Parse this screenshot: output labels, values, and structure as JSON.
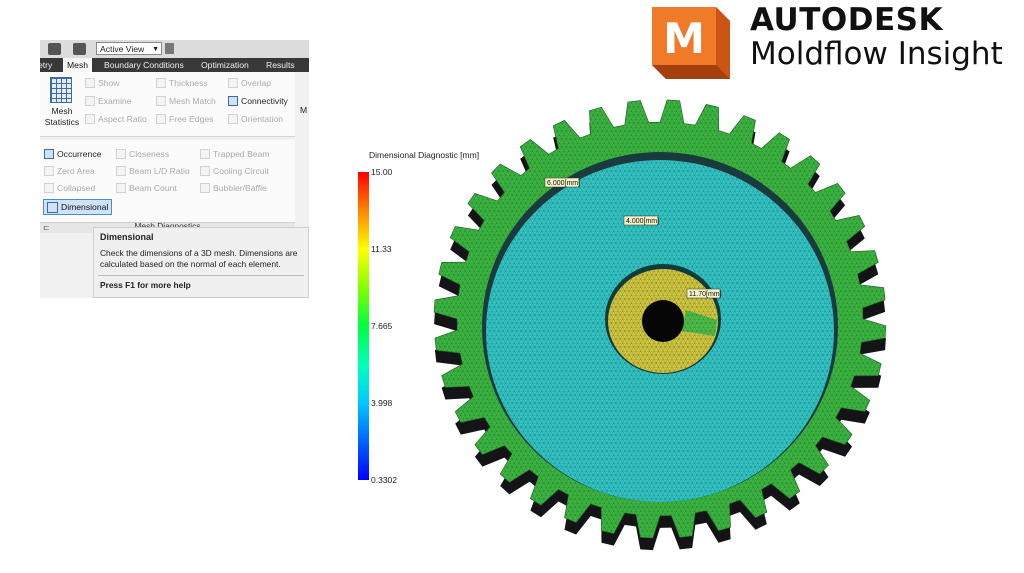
{
  "ribbon": {
    "quick_access": {
      "view_select": "Active View"
    },
    "tabs": [
      {
        "label": "etry"
      },
      {
        "label": "Mesh"
      },
      {
        "label": "Boundary Conditions"
      },
      {
        "label": "Optimization"
      },
      {
        "label": "Results"
      }
    ],
    "mesh_stats_label": "Mesh Statistics",
    "truncated_label": "M",
    "top_items": {
      "show": "Show",
      "examine": "Examine",
      "aspect_ratio": "Aspect Ratio",
      "thickness": "Thickness",
      "mesh_match": "Mesh Match",
      "free_edges": "Free Edges",
      "overlap": "Overlap",
      "connectivity": "Connectivity",
      "orientation": "Orientation"
    },
    "diag_items": {
      "occurrence": "Occurrence",
      "zero_area": "Zero Area",
      "collapsed": "Collapsed",
      "closeness": "Closeness",
      "beam_ld_ratio": "Beam L/D Ratio",
      "beam_count": "Beam Count",
      "trapped_beam": "Trapped Beam",
      "cooling_circuit": "Cooling Circuit",
      "bubbler_baffle": "Bubbler/Baffle",
      "dimensional": "Dimensional"
    },
    "group_label": "Mesh Diagnostics",
    "tooltip": {
      "title": "Dimensional",
      "body": "Check the dimensions of a 3D mesh. Dimensions are calculated based on the normal of each element.",
      "help": "Press F1 for more help"
    }
  },
  "logo": {
    "line1": "AUTODESK",
    "line2": "Moldflow Insight",
    "mark_letter": "M",
    "mark_color": "#e8661c"
  },
  "legend": {
    "title": "Dimensional Diagnostic [mm]",
    "ticks": [
      "15.00",
      "11.33",
      "7.665",
      "3.998",
      "0.3302"
    ]
  },
  "annotations": {
    "outer": "6.000[mm]",
    "web": "4.000[mm]",
    "hub": "11.70[mm]"
  },
  "colors": {
    "rim": "#3cb83c",
    "web": "#33c6c6",
    "hub": "#d6c83a",
    "hub_accent": "#4fbf45",
    "base": "#141418"
  }
}
